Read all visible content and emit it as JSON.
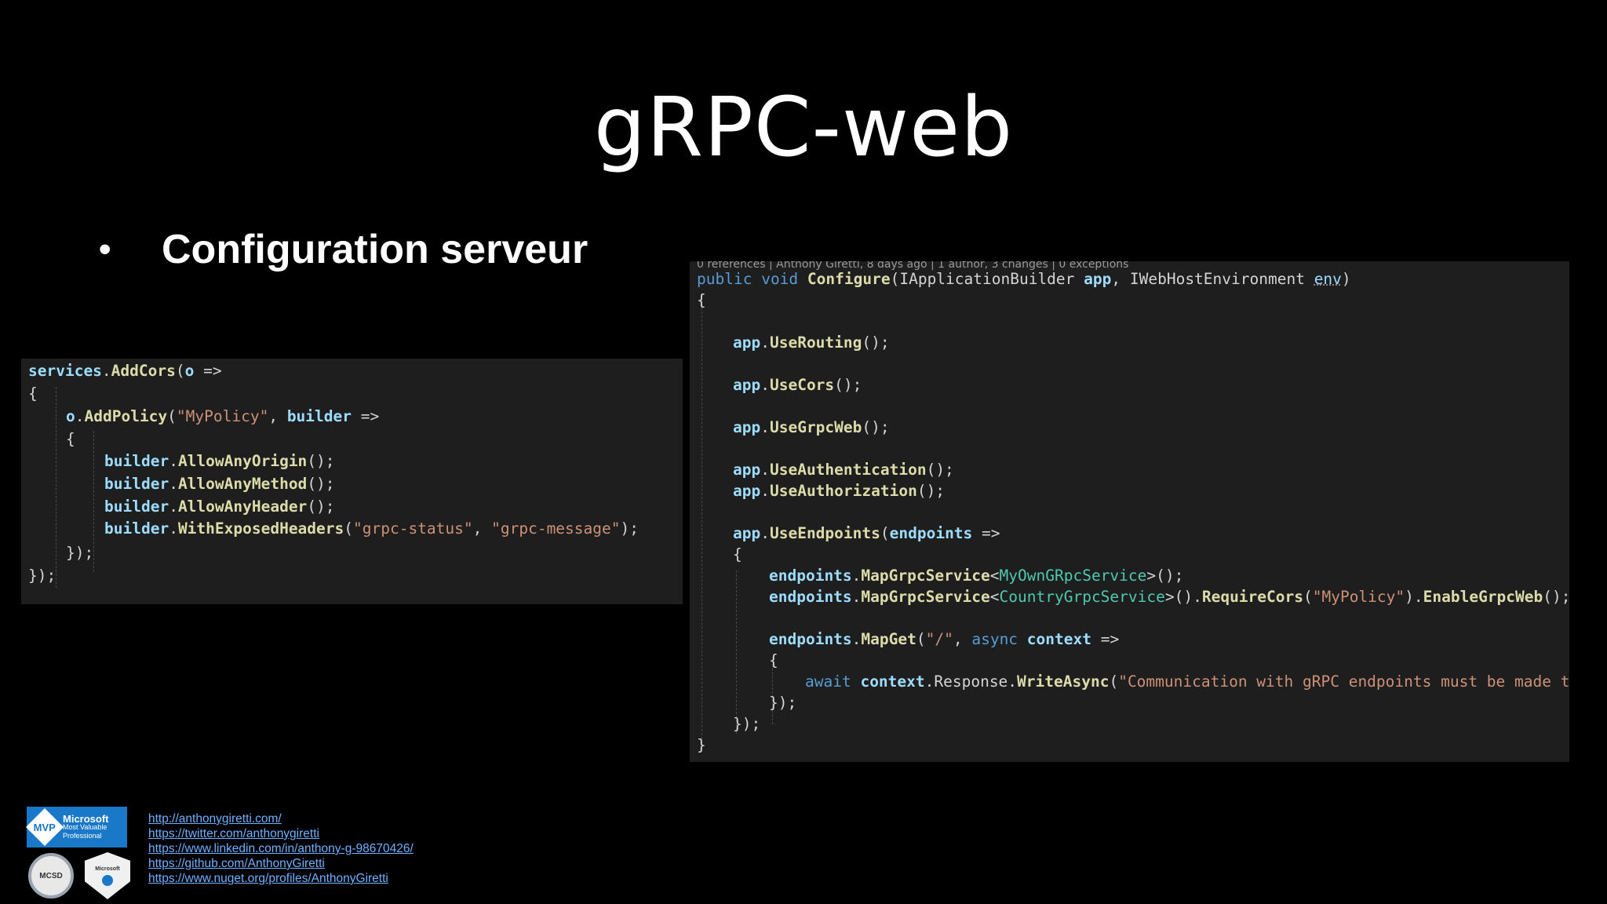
{
  "slide": {
    "title": "gRPC-web",
    "bullet": "Configuration serveur"
  },
  "code_left": {
    "l1": {
      "a": "services",
      "b": ".",
      "c": "AddCors",
      "d": "(",
      "e": "o",
      "f": " =>"
    },
    "l2": "{",
    "l3": {
      "a": "o",
      "b": ".",
      "c": "AddPolicy",
      "d": "(",
      "e": "\"MyPolicy\"",
      "f": ", ",
      "g": "builder",
      "h": " =>"
    },
    "l4": "{",
    "l5": {
      "a": "builder",
      "b": ".",
      "c": "AllowAnyOrigin",
      "d": "();"
    },
    "l6": {
      "a": "builder",
      "b": ".",
      "c": "AllowAnyMethod",
      "d": "();"
    },
    "l7": {
      "a": "builder",
      "b": ".",
      "c": "AllowAnyHeader",
      "d": "();"
    },
    "l8": {
      "a": "builder",
      "b": ".",
      "c": "WithExposedHeaders",
      "d": "(",
      "e": "\"grpc-status\"",
      "f": ", ",
      "g": "\"grpc-message\"",
      "h": ");"
    },
    "l9": "});",
    "l10": "});"
  },
  "code_right": {
    "codelens": "0 references | Anthony Giretti, 8 days ago | 1 author, 3 changes | 0 exceptions",
    "l1": {
      "a": "public",
      "b": " ",
      "c": "void",
      "d": " ",
      "e": "Configure",
      "f": "(",
      "g": "IApplicationBuilder",
      "h": " ",
      "i": "app",
      "j": ", ",
      "k": "IWebHostEnvironment",
      "l": " ",
      "m": "env",
      "n": ")"
    },
    "l2": "{",
    "r1": {
      "a": "app",
      "b": ".",
      "c": "UseRouting",
      "d": "();"
    },
    "r2": {
      "a": "app",
      "b": ".",
      "c": "UseCors",
      "d": "();"
    },
    "r3": {
      "a": "app",
      "b": ".",
      "c": "UseGrpcWeb",
      "d": "();"
    },
    "r4": {
      "a": "app",
      "b": ".",
      "c": "UseAuthentication",
      "d": "();"
    },
    "r5": {
      "a": "app",
      "b": ".",
      "c": "UseAuthorization",
      "d": "();"
    },
    "r6": {
      "a": "app",
      "b": ".",
      "c": "UseEndpoints",
      "d": "(",
      "e": "endpoints",
      "f": " =>"
    },
    "r7": "{",
    "r8": {
      "a": "endpoints",
      "b": ".",
      "c": "MapGrpcService",
      "d": "<",
      "e": "MyOwnGRpcService",
      "f": ">();"
    },
    "r9": {
      "a": "endpoints",
      "b": ".",
      "c": "MapGrpcService",
      "d": "<",
      "e": "CountryGrpcService",
      "f": ">().",
      "g": "RequireCors",
      "h": "(",
      "i": "\"MyPolicy\"",
      "j": ").",
      "k": "EnableGrpcWeb",
      "l": "();"
    },
    "r10": {
      "a": "endpoints",
      "b": ".",
      "c": "MapGet",
      "d": "(",
      "e": "\"/\"",
      "f": ", ",
      "g": "async",
      "h": " ",
      "i": "context",
      "j": " =>"
    },
    "r11": "{",
    "r12": {
      "a": "await",
      "b": " ",
      "c": "context",
      "d": ".Response.",
      "e": "WriteAsync",
      "f": "(",
      "g": "\"Communication with gRPC endpoints must be made through a gRPC client."
    },
    "r13": "});",
    "r14": "});",
    "r15": "}"
  },
  "links": [
    "http://anthonygiretti.com/",
    "https://twitter.com/anthonygiretti",
    "https://www.linkedin.com/in/anthony-g-98670426/",
    "https://github.com/AnthonyGiretti",
    "https://www.nuget.org/profiles/AnthonyGiretti"
  ],
  "badges": {
    "mvp_short": "MVP",
    "mvp_brand": "Microsoft",
    "mvp_line1": "Most Valuable",
    "mvp_line2": "Professional",
    "mcsd": "MCSD",
    "shield_line": "Microsoft"
  }
}
